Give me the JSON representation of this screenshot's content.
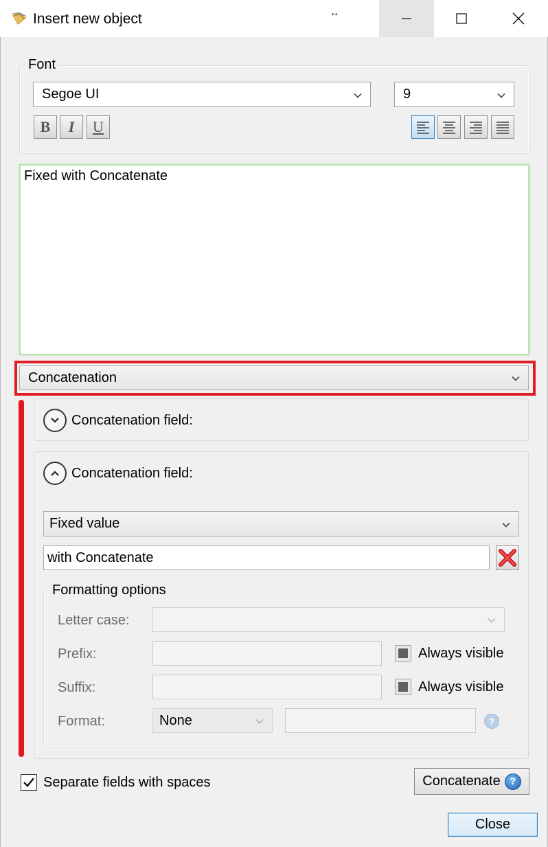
{
  "window": {
    "title": "Insert new object",
    "resize_glyph": "↔"
  },
  "font_group": {
    "legend": "Font",
    "font_family": "Segoe UI",
    "font_size": "9",
    "bold_glyph": "B",
    "italic_glyph": "I",
    "underline_glyph": "U"
  },
  "editor": {
    "text": "Fixed with Concatenate"
  },
  "type_combo": {
    "value": "Concatenation"
  },
  "concat_collapsed": {
    "label": "Concatenation field:"
  },
  "concat_expanded": {
    "label": "Concatenation field:",
    "source_value": "Fixed value",
    "value_text": "with Concatenate"
  },
  "formatting": {
    "legend": "Formatting options",
    "letter_case_label": "Letter case:",
    "letter_case_value": "",
    "prefix_label": "Prefix:",
    "prefix_value": "",
    "suffix_label": "Suffix:",
    "suffix_value": "",
    "always_visible_label": "Always visible",
    "always_visible_label_2": "Always visible",
    "format_label": "Format:",
    "format_value": "None",
    "format_extra": "",
    "help_glyph": "?"
  },
  "footer": {
    "separate_label": "Separate fields with spaces",
    "separate_checked": true,
    "concatenate_label": "Concatenate",
    "help_glyph": "?",
    "close_label": "Close"
  },
  "colors": {
    "highlight_red": "#e01e24",
    "accent_blue": "#3c7fb1"
  }
}
